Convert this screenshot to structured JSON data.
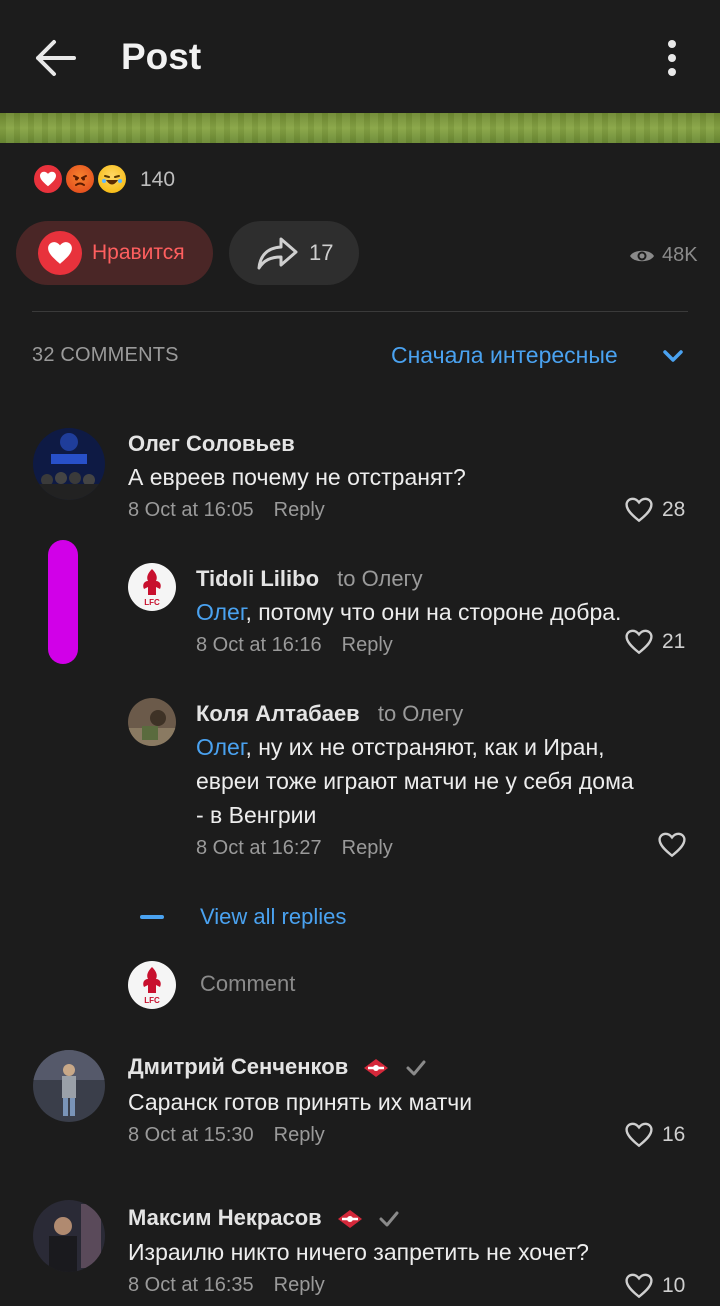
{
  "header": {
    "title": "Post",
    "back_icon": "arrow-left-icon",
    "menu_icon": "more-vertical-icon"
  },
  "reactions": {
    "icons": [
      "heart-emoji",
      "angry-emoji",
      "laughing-emoji"
    ],
    "count": "140"
  },
  "actions": {
    "like_label": "Нравится",
    "share_count": "17",
    "views": "48K"
  },
  "comments_header": {
    "count_label": "32 COMMENTS",
    "sort_label": "Сначала интересные"
  },
  "comments": [
    {
      "author": "Олег Соловьев",
      "text": "А евреев почему не отстранят?",
      "date": "8 Oct at 16:05",
      "reply": "Reply",
      "likes": "28"
    },
    {
      "author": "Tidoli Lilibo",
      "to": "to Олегу",
      "mention": "Олег",
      "text": ", потому что они на стороне добра.",
      "date": "8 Oct at 16:16",
      "reply": "Reply",
      "likes": "21"
    },
    {
      "author": "Коля Алтабаев",
      "to": "to Олегу",
      "mention": "Олег",
      "text_line1": ", ну их не отстраняют, как и Иран,",
      "text_line2": "евреи тоже играют матчи не у себя дома",
      "text_line3": "- в Венгрии",
      "date": "8 Oct at 16:27",
      "reply": "Reply"
    },
    {
      "author": "Дмитрий Сенченков",
      "text": "Саранск готов принять их матчи",
      "date": "8 Oct at 15:30",
      "reply": "Reply",
      "likes": "16"
    },
    {
      "author": "Максим Некрасов",
      "text": "Израилю никто ничего запретить не хочет?",
      "date": "8 Oct at 16:35",
      "reply": "Reply",
      "likes": "10"
    }
  ],
  "thread": {
    "view_all": "View all replies",
    "comment_placeholder": "Comment"
  },
  "colors": {
    "accent": "#4aa2f0",
    "like_red": "#e8323c",
    "background": "#1c1c1c",
    "marker": "#d100e8"
  }
}
